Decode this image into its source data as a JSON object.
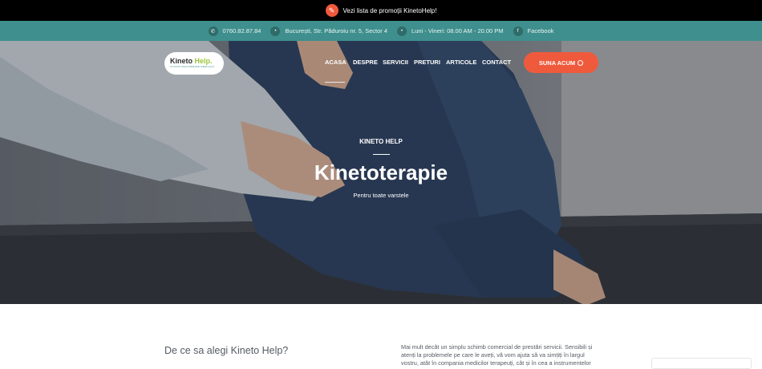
{
  "promo": {
    "text": "Vezi lista de promoții KinetoHelp!",
    "icon": "tag-icon"
  },
  "contact": [
    {
      "icon": "phone-icon",
      "text": "0760.82.87.84"
    },
    {
      "icon": "map-pin-icon",
      "text": "București, Str. Păduroiu nr. 5, Sector 4"
    },
    {
      "icon": "clock-icon",
      "text": "Luni - Vineri: 08.00 AM - 20.00 PM"
    },
    {
      "icon": "facebook-icon",
      "text": "Facebook"
    }
  ],
  "logo": {
    "main_a": "Kineto",
    "main_b": "Help.",
    "sub": "CLINICĂ RECUPERARE MEDICALĂ"
  },
  "nav": [
    "ACASA",
    "DESPRE",
    "SERVICII",
    "PRETURI",
    "ARTICOLE",
    "CONTACT"
  ],
  "cta": {
    "label": "SUNA ACUM",
    "icon": "phone-circle-icon"
  },
  "hero": {
    "kicker": "KINETO HELP",
    "title": "Kinetoterapie",
    "subtitle": "Pentru toate varstele"
  },
  "about": {
    "title": "De ce sa alegi Kineto Help?",
    "text": "Mai mult decât un simplu schimb comercial de prestări servicii. Sensibili și atenți la problemele pe care le aveți, vă vom ajuta să va simțiți în largul vostru, atât în compania medicilor terapeuți, cât și în cea a instrumentelor"
  },
  "colors": {
    "accent": "#f05a3c",
    "teal": "#3e8f8d",
    "brand_green": "#9cc63c"
  }
}
